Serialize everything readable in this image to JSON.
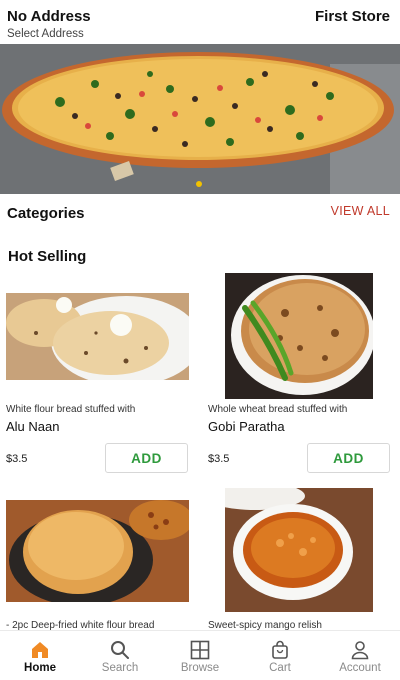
{
  "header": {
    "address_title": "No Address",
    "address_subtitle": "Select Address",
    "store_name": "First Store"
  },
  "banner": {
    "image": "pizza-photo",
    "active_slide_indicator_color": "#f2c200"
  },
  "categories": {
    "title": "Categories",
    "view_all": "VIEW ALL",
    "view_all_color": "#c0392b"
  },
  "hot_selling": {
    "title": "Hot Selling",
    "products": [
      {
        "image": "naan-photo",
        "description": "White flour bread stuffed with",
        "name": "Alu Naan",
        "price": "$3.5",
        "add_label": "ADD"
      },
      {
        "image": "paratha-photo",
        "description": "Whole wheat bread stuffed with",
        "name": "Gobi Paratha",
        "price": "$3.5",
        "add_label": "ADD"
      },
      {
        "image": "puri-photo",
        "description": "- 2pc Deep-fried white flour bread"
      },
      {
        "image": "relish-photo",
        "description": "Sweet-spicy mango relish"
      }
    ],
    "add_color": "#2e9a3c"
  },
  "bottom_nav": {
    "active_color": "#f08a24",
    "items": [
      {
        "label": "Home",
        "icon": "home-icon",
        "active": true
      },
      {
        "label": "Search",
        "icon": "search-icon",
        "active": false
      },
      {
        "label": "Browse",
        "icon": "browse-grid-icon",
        "active": false
      },
      {
        "label": "Cart",
        "icon": "cart-bag-icon",
        "active": false
      },
      {
        "label": "Account",
        "icon": "account-icon",
        "active": false
      }
    ]
  }
}
